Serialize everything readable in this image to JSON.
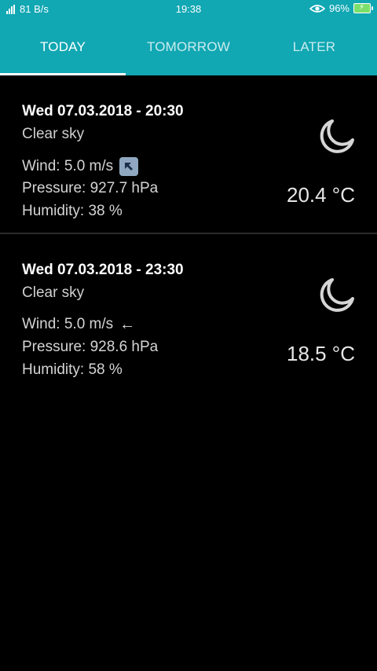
{
  "status_bar": {
    "network_speed": "81 B/s",
    "time": "19:38",
    "battery": "96%",
    "icons": [
      "signal-icon",
      "eye-icon",
      "battery-charging-icon"
    ]
  },
  "tabs": [
    {
      "label": "TODAY",
      "active": true
    },
    {
      "label": "TOMORROW",
      "active": false
    },
    {
      "label": "LATER",
      "active": false
    }
  ],
  "forecasts": [
    {
      "datetime": "Wed 07.03.2018 - 20:30",
      "description": "Clear sky",
      "wind": "Wind: 5.0 m/s",
      "wind_icon": "arrow-up-left-boxed",
      "pressure": "Pressure: 927.7 hPa",
      "humidity": "Humidity: 38 %",
      "temperature": "20.4 °C",
      "weather_icon": "moon-icon"
    },
    {
      "datetime": "Wed 07.03.2018 - 23:30",
      "description": "Clear sky",
      "wind": "Wind: 5.0 m/s",
      "wind_icon": "arrow-left",
      "pressure": "Pressure: 928.6 hPa",
      "humidity": "Humidity: 58 %",
      "temperature": "18.5 °C",
      "weather_icon": "moon-icon"
    }
  ],
  "colors": {
    "accent": "#11a7b3",
    "background": "#000000",
    "text": "#ffffff"
  }
}
